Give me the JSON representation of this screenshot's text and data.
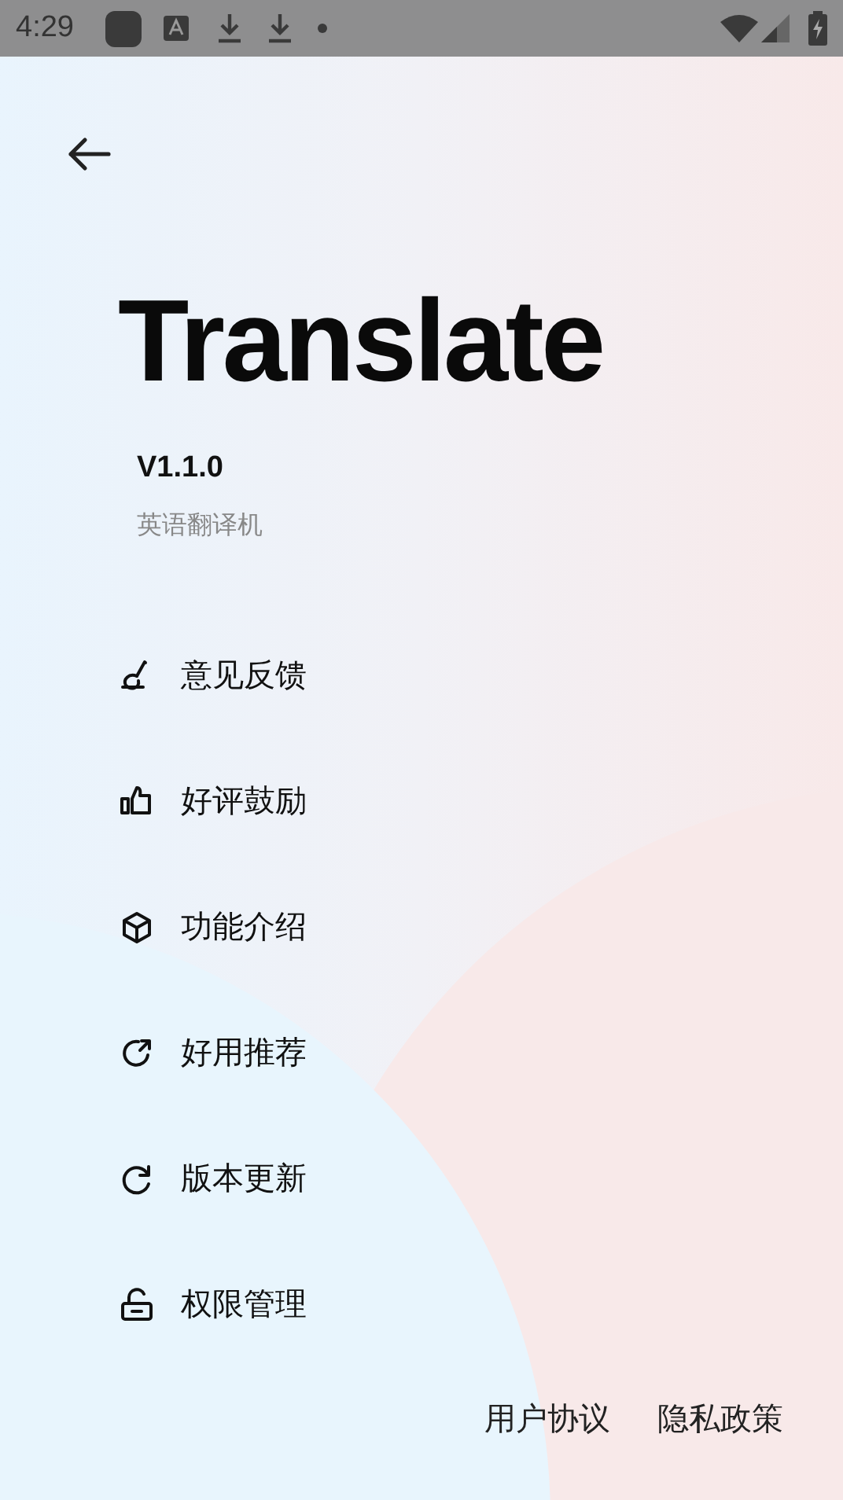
{
  "status_bar": {
    "time": "4:29"
  },
  "app": {
    "name": "Translate",
    "version": "V1.1.0",
    "subtitle": "英语翻译机"
  },
  "menu": [
    {
      "kind": "feedback",
      "label": "意见反馈"
    },
    {
      "kind": "rate",
      "label": "好评鼓励"
    },
    {
      "kind": "features",
      "label": "功能介绍"
    },
    {
      "kind": "share",
      "label": "好用推荐"
    },
    {
      "kind": "update",
      "label": "版本更新"
    },
    {
      "kind": "permissions",
      "label": "权限管理"
    }
  ],
  "footer_links": [
    "用户协议",
    "隐私政策"
  ]
}
